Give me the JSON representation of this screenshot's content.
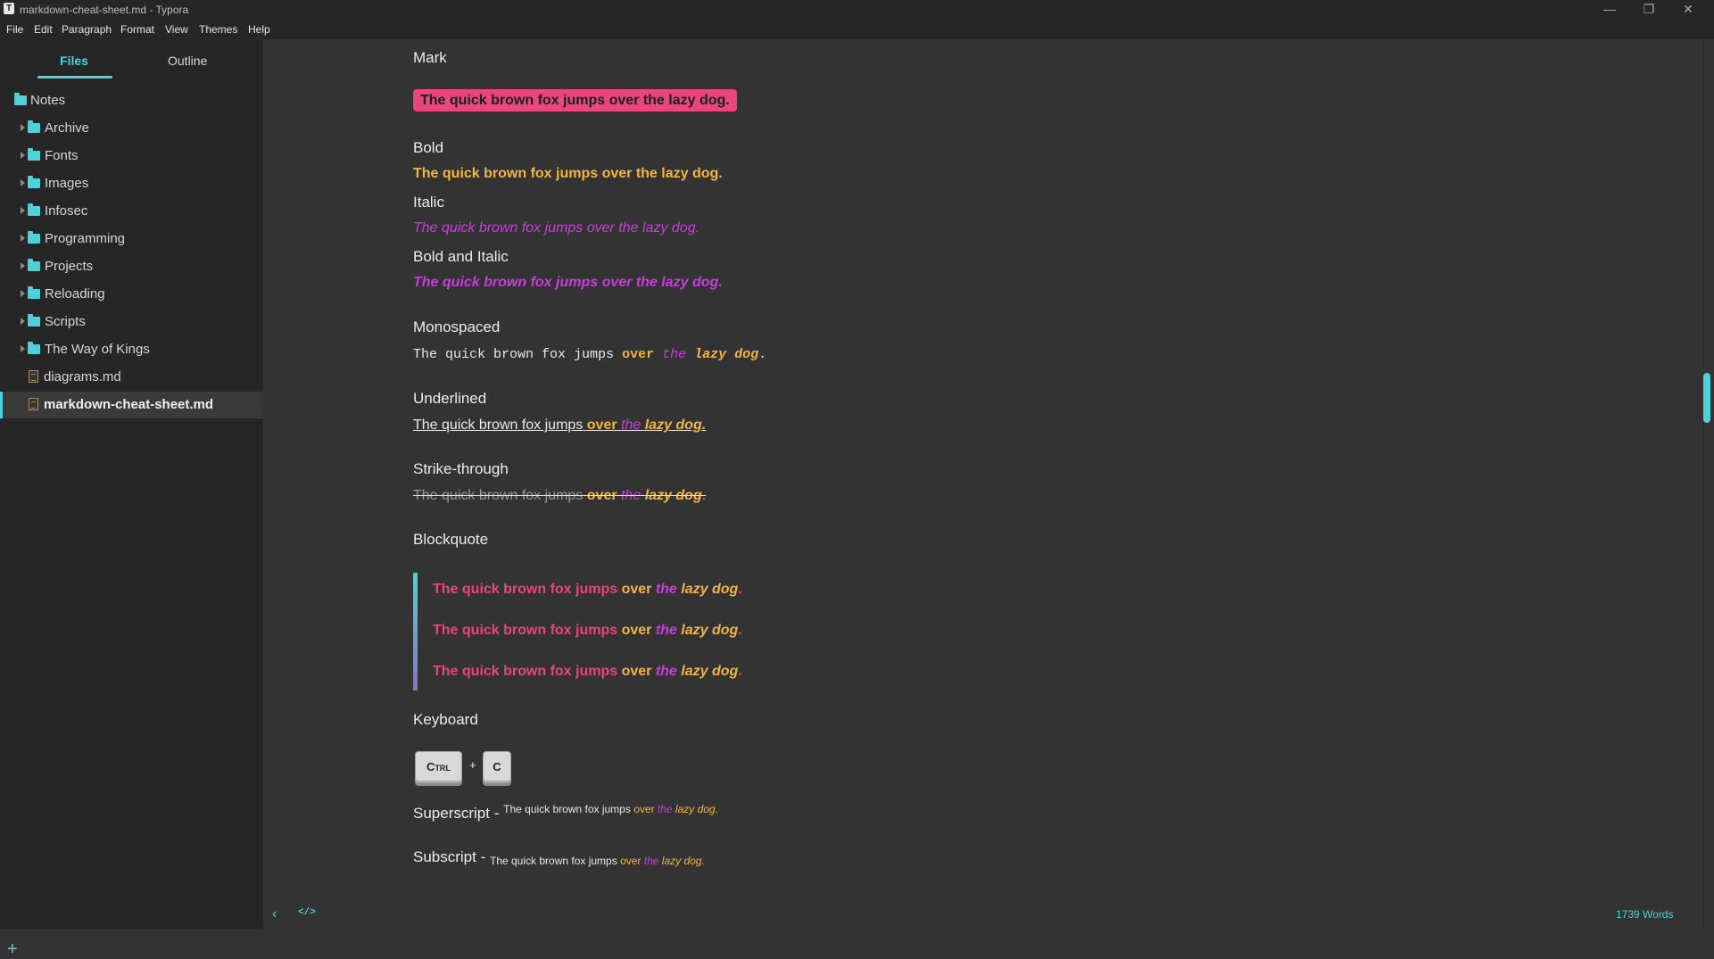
{
  "window": {
    "title": "markdown-cheat-sheet.md - Typora",
    "app_icon": "T",
    "controls": [
      "minimize-icon",
      "restore-icon",
      "close-icon"
    ]
  },
  "menu": [
    "File",
    "Edit",
    "Paragraph",
    "Format",
    "View",
    "Themes",
    "Help"
  ],
  "sidebar": {
    "tabs": [
      "Files",
      "Outline"
    ],
    "active_tab": "Files",
    "root": "Notes",
    "folders": [
      "Archive",
      "Fonts",
      "Images",
      "Infosec",
      "Programming",
      "Projects",
      "Reloading",
      "Scripts",
      "The Way of Kings"
    ],
    "files": [
      "diagrams.md",
      "markdown-cheat-sheet.md"
    ],
    "selected_file": "markdown-cheat-sheet.md",
    "add_icon": "plus-icon"
  },
  "doc": {
    "phrase": {
      "the_quick_brown_fox_jumps": "The quick brown fox jumps",
      "over": "over",
      "the": "the",
      "lazy_dog": "lazy dog",
      "period": ".",
      "full": "The quick brown fox jumps over the lazy dog."
    },
    "mark_heading": "Mark",
    "bold_heading": "Bold",
    "italic_heading": "Italic",
    "bold_italic_heading": "Bold and Italic",
    "mono_heading": "Monospaced",
    "underline_heading": "Underlined",
    "strike_heading": "Strike-through",
    "blockquote_heading": "Blockquote",
    "keyboard_heading": "Keyboard",
    "kbd": {
      "ctrl": "Ctrl",
      "plus": "+",
      "c": "C"
    },
    "superscript_label": "Superscript -",
    "subscript_label": "Subscript -"
  },
  "footer": {
    "word_count": "1739 Words",
    "icons": [
      "chevron-left-icon",
      "source-code-icon"
    ]
  },
  "colors": {
    "accent": "#4fd1d9",
    "mark": "#e8467c",
    "bold": "#f2b544",
    "italic": "#c73fdb"
  }
}
